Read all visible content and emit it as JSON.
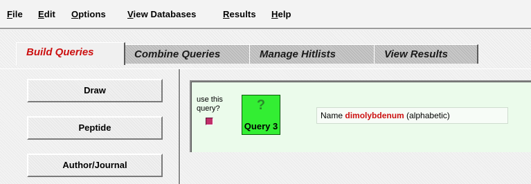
{
  "menubar": {
    "items": [
      {
        "mnemonic": "F",
        "rest": "ile"
      },
      {
        "mnemonic": "E",
        "rest": "dit"
      },
      {
        "mnemonic": "O",
        "rest": "ptions"
      },
      {
        "mnemonic": "V",
        "rest": "iew Databases"
      },
      {
        "mnemonic": "R",
        "rest": "esults"
      },
      {
        "mnemonic": "H",
        "rest": "elp"
      }
    ]
  },
  "tabs": [
    {
      "label": "Build Queries",
      "active": true
    },
    {
      "label": "Combine Queries",
      "active": false
    },
    {
      "label": "Manage Hitlists",
      "active": false
    },
    {
      "label": "View Results",
      "active": false
    }
  ],
  "left_panel": {
    "buttons": [
      {
        "label": "Draw"
      },
      {
        "label": "Peptide"
      },
      {
        "label": "Author/Journal"
      }
    ]
  },
  "query": {
    "use_label": "use this query?",
    "checked": true,
    "icon_glyph": "?",
    "name": "Query 3",
    "field_prefix": "Name",
    "term": "dimolybdenum",
    "suffix": "(alphabetic)"
  },
  "colors": {
    "active_tab_text": "#cc1111",
    "query_box": "#33ee33",
    "query_panel_bg": "#ebfbeb",
    "checkbox": "#c0306a",
    "term_text": "#cc1111"
  }
}
